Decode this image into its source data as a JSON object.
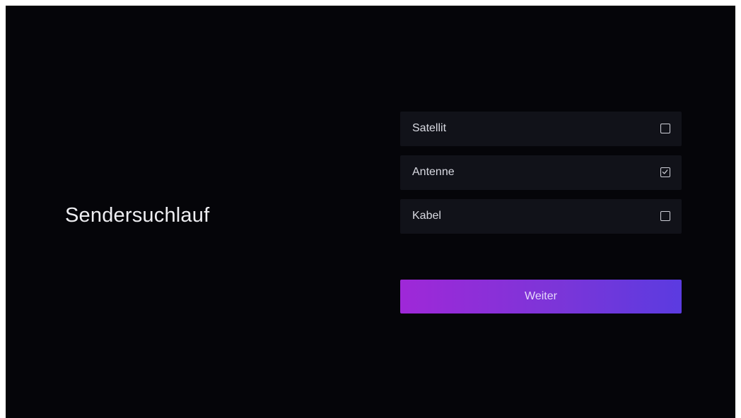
{
  "screen": {
    "title": "Sendersuchlauf"
  },
  "options": [
    {
      "label": "Satellit",
      "checked": false,
      "icon": "checkbox-empty-icon"
    },
    {
      "label": "Antenne",
      "checked": true,
      "icon": "checkbox-checked-icon"
    },
    {
      "label": "Kabel",
      "checked": false,
      "icon": "checkbox-empty-icon"
    }
  ],
  "next_button": {
    "label": "Weiter"
  },
  "colors": {
    "background": "#050509",
    "option_background": "#111219",
    "accent_start": "#9f28d8",
    "accent_end": "#5b3be0"
  }
}
